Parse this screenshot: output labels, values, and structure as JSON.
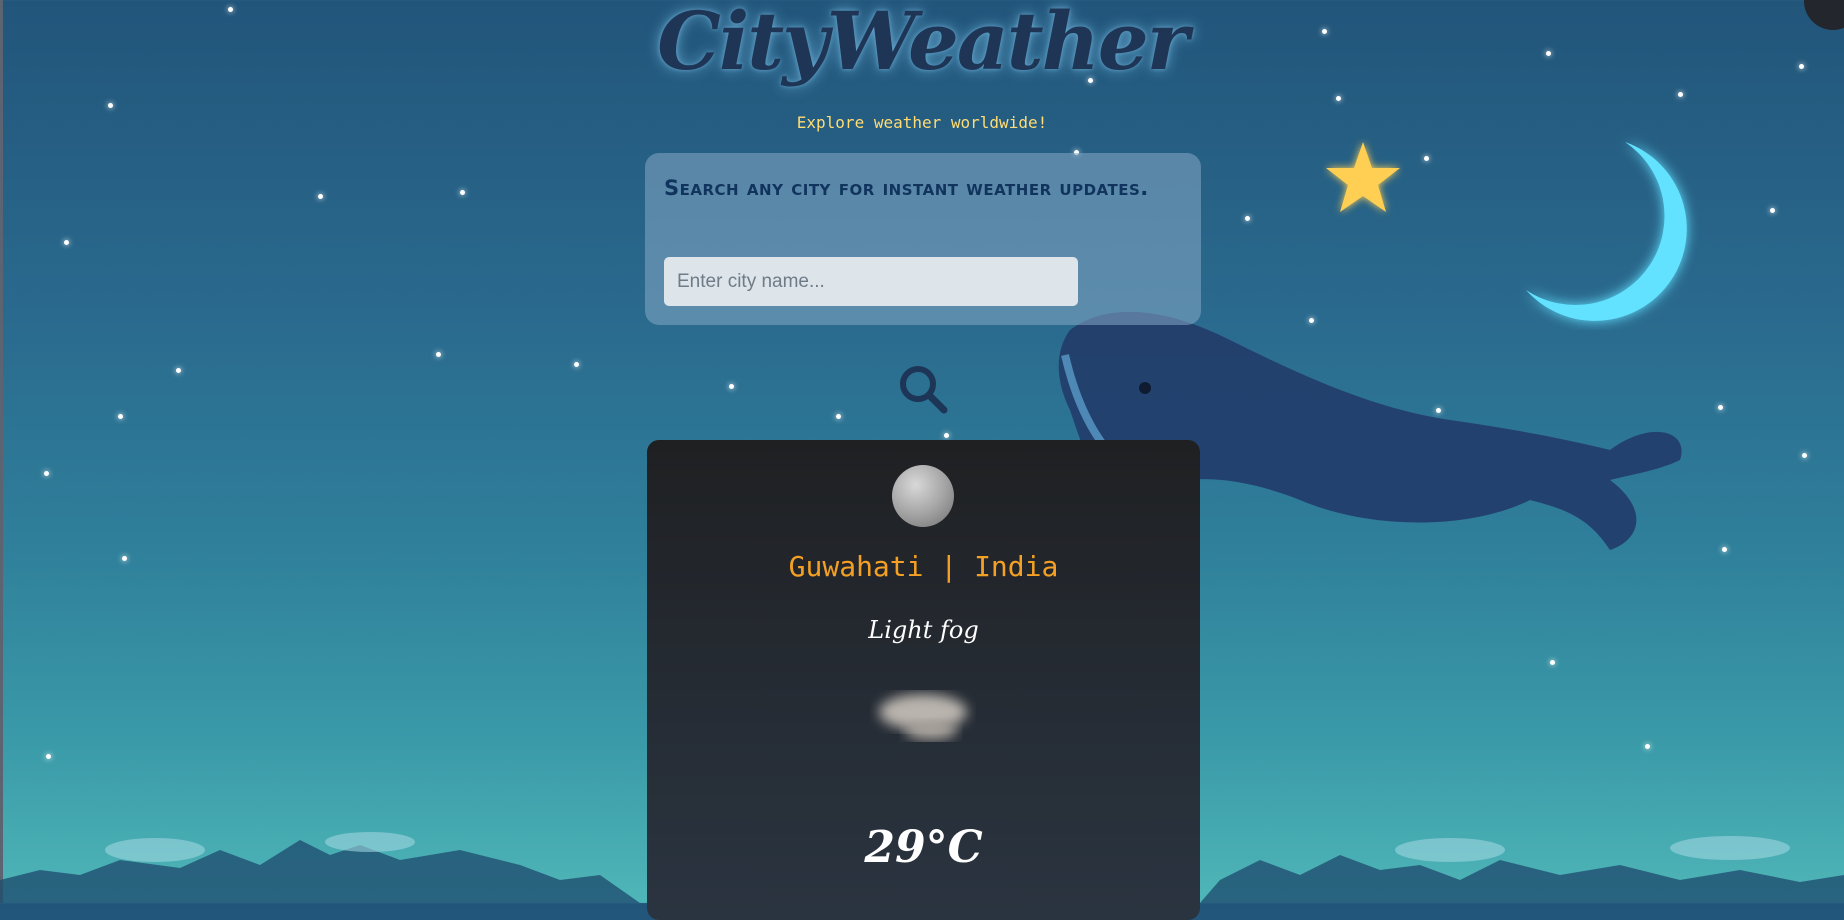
{
  "app": {
    "title": "CityWeather",
    "subtitle": "Explore weather worldwide!"
  },
  "search": {
    "heading": "Search any city for instant weather updates.",
    "placeholder": "Enter city name...",
    "value": ""
  },
  "weather": {
    "location": "Guwahati | India",
    "condition": "Light fog",
    "temperature": "29°C"
  },
  "colors": {
    "title": "#1e3556",
    "subtitle": "#ffdc74",
    "location": "#f4a024",
    "moon_glow": "#66e6ff",
    "card_bg": "#1f2022"
  },
  "icons": [
    "search-icon",
    "moon-icon",
    "fog-icon",
    "crescent-moon-icon",
    "star-icon",
    "whale-illustration"
  ]
}
